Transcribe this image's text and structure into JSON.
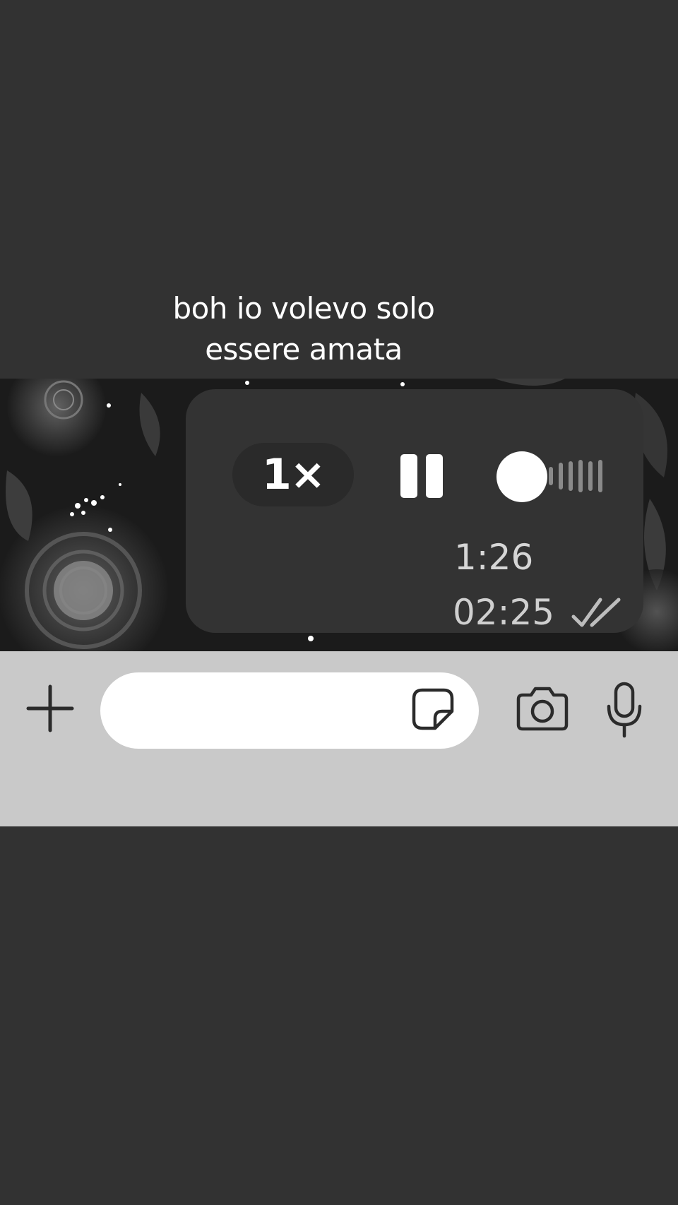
{
  "caption": {
    "line1": "boh io volevo solo",
    "line2": "essere amata"
  },
  "voice_message": {
    "playback_speed": "1×",
    "duration": "1:26",
    "timestamp": "02:25",
    "status_icon": "double-check-icon",
    "play_state_icon": "pause-icon",
    "progress": 0.0
  },
  "composer": {
    "message_value": "",
    "message_placeholder": "",
    "attach_icon": "plus-icon",
    "sticker_icon": "sticker-icon",
    "camera_icon": "camera-icon",
    "mic_icon": "microphone-icon"
  },
  "colors": {
    "background": "#323232",
    "bubble": "#333333",
    "input_bar": "#c9c9c9",
    "text": "#ffffff"
  }
}
